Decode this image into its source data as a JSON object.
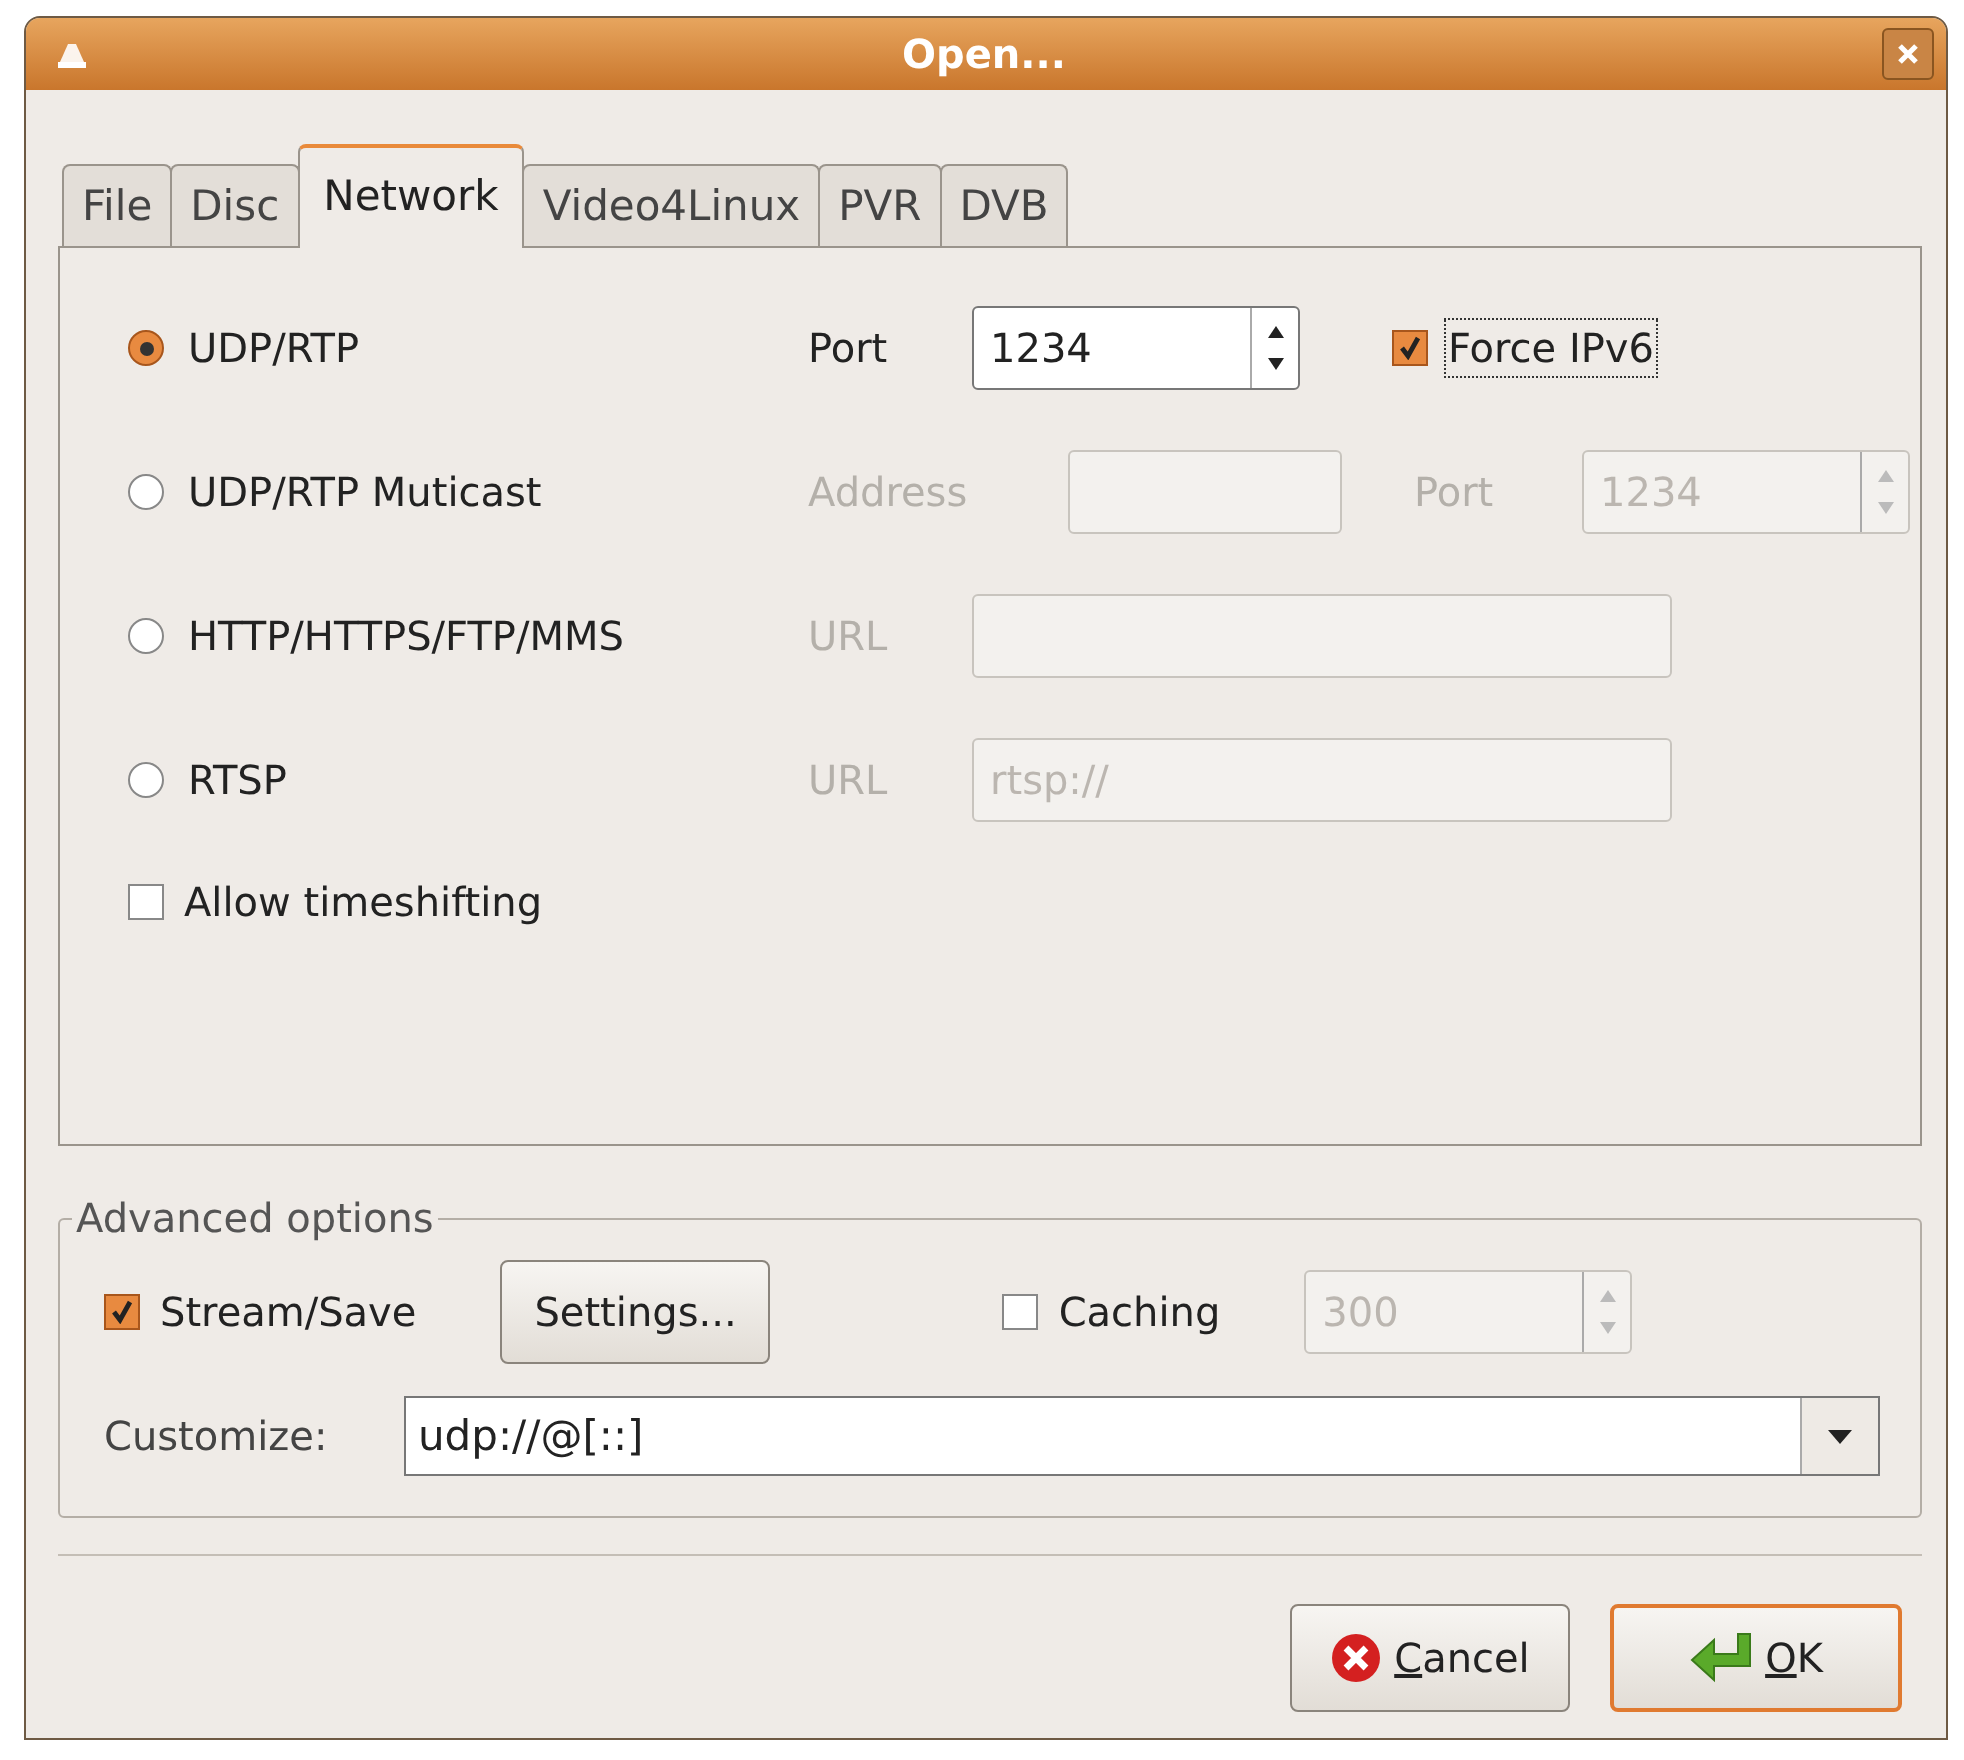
{
  "window": {
    "title": "Open..."
  },
  "tabs": [
    {
      "label": "File",
      "selected": false
    },
    {
      "label": "Disc",
      "selected": false
    },
    {
      "label": "Network",
      "selected": true
    },
    {
      "label": "Video4Linux",
      "selected": false
    },
    {
      "label": "PVR",
      "selected": false
    },
    {
      "label": "DVB",
      "selected": false
    }
  ],
  "protocols": [
    {
      "label": "UDP/RTP",
      "selected": true,
      "fields": [
        {
          "kind": "spin",
          "label": "Port",
          "value": "1234",
          "disabled": false
        },
        {
          "kind": "checkbox",
          "label": "Force IPv6",
          "checked": true,
          "focused": true
        }
      ]
    },
    {
      "label": "UDP/RTP Muticast",
      "selected": false,
      "fields": [
        {
          "kind": "text",
          "label": "Address",
          "disabled": true
        },
        {
          "kind": "spin",
          "label": "Port",
          "value": "1234",
          "disabled": true
        }
      ]
    },
    {
      "label": "HTTP/HTTPS/FTP/MMS",
      "selected": false,
      "fields": [
        {
          "kind": "text",
          "label": "URL",
          "disabled": true
        }
      ]
    },
    {
      "label": "RTSP",
      "selected": false,
      "fields": [
        {
          "kind": "text",
          "label": "URL",
          "value": "rtsp://",
          "disabled": true
        }
      ]
    }
  ],
  "timeshift": {
    "label": "Allow timeshifting",
    "checked": false
  },
  "advanced": {
    "title": "Advanced options",
    "stream_save": {
      "label": "Stream/Save",
      "checked": true
    },
    "settings_button": "Settings...",
    "caching": {
      "label": "Caching",
      "checked": false,
      "value": "300",
      "disabled": true
    },
    "customize": {
      "label": "Customize:",
      "value": "udp://@[::]"
    }
  },
  "buttons": [
    {
      "kind": "cancel",
      "label": "Cancel",
      "default": false
    },
    {
      "kind": "ok",
      "label": "OK",
      "default": true
    }
  ]
}
